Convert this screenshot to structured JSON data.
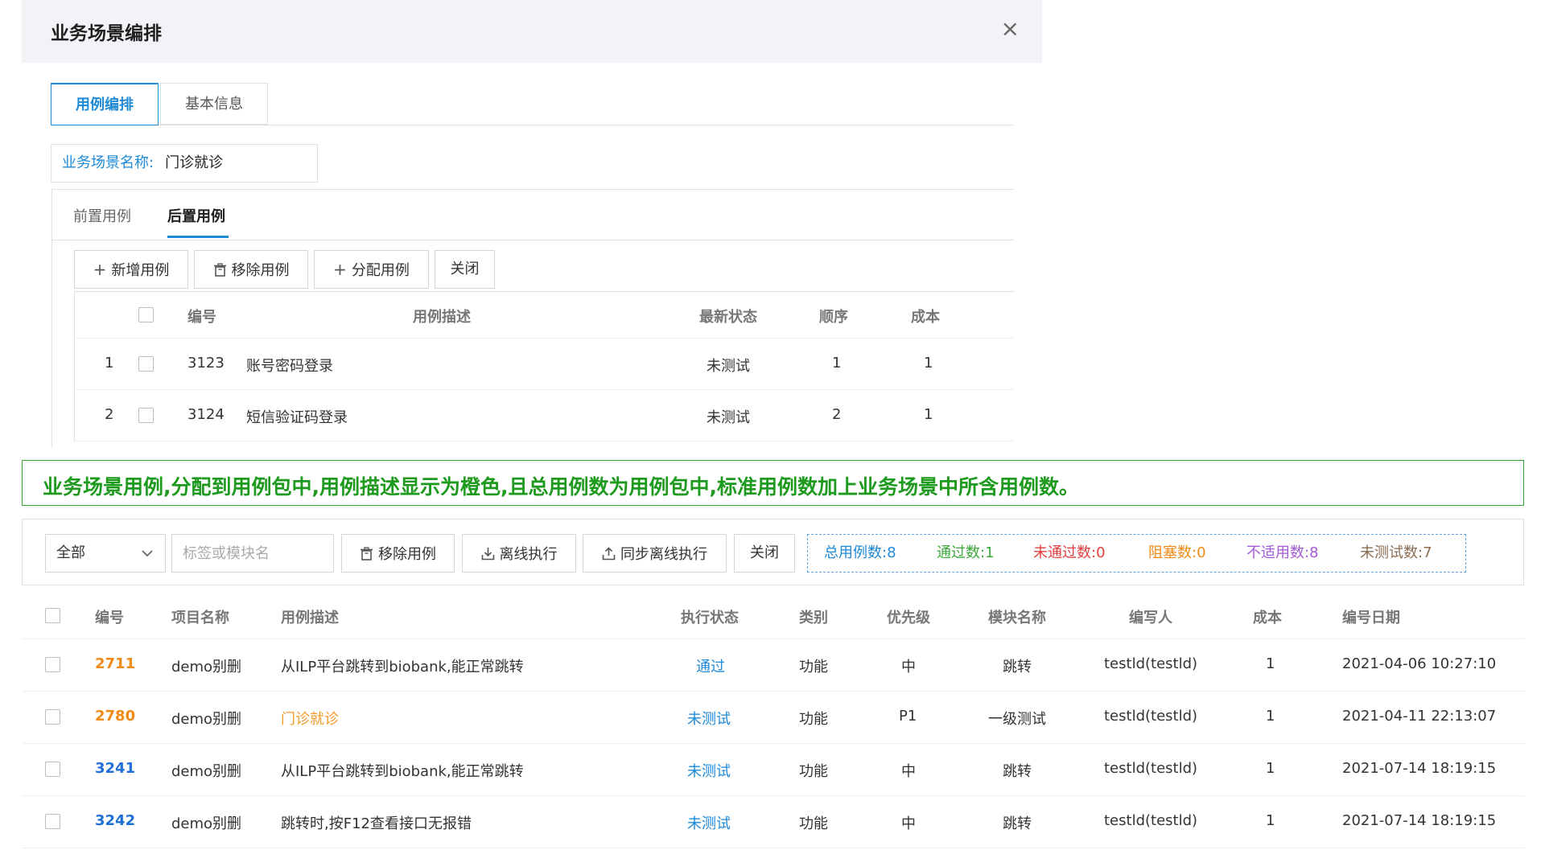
{
  "modal": {
    "title": "业务场景编排",
    "close_glyph": "×",
    "tabs": [
      {
        "label": "用例编排"
      },
      {
        "label": "基本信息"
      }
    ],
    "scene_name": {
      "label": "业务场景名称:",
      "value": "门诊就诊"
    },
    "inner_tabs": [
      {
        "label": "前置用例"
      },
      {
        "label": "后置用例"
      }
    ],
    "toolbar": {
      "add": "新增用例",
      "remove": "移除用例",
      "assign": "分配用例",
      "close": "关闭"
    },
    "table": {
      "headers": {
        "id": "编号",
        "desc": "用例描述",
        "status": "最新状态",
        "order": "顺序",
        "cost": "成本"
      },
      "rows": [
        {
          "index": "1",
          "id": "3123",
          "desc": "账号密码登录",
          "status": "未测试",
          "order": "1",
          "cost": "1"
        },
        {
          "index": "2",
          "id": "3124",
          "desc": "短信验证码登录",
          "status": "未测试",
          "order": "2",
          "cost": "1"
        }
      ]
    }
  },
  "banner": {
    "text": "业务场景用例,分配到用例包中,用例描述显示为橙色,且总用例数为用例包中,标准用例数加上业务场景中所含用例数。",
    "color": "#1e9a1e"
  },
  "lower": {
    "filter": {
      "selected": "全部",
      "placeholder": "标签或模块名"
    },
    "toolbar": {
      "remove": "移除用例",
      "offline": "离线执行",
      "sync_offline": "同步离线执行",
      "close": "关闭"
    },
    "stats": {
      "total": "总用例数:8",
      "pass": "通过数:1",
      "fail": "未通过数:0",
      "blocked": "阻塞数:0",
      "na": "不适用数:8",
      "untested": "未测试数:7"
    },
    "table": {
      "headers": {
        "id": "编号",
        "project": "项目名称",
        "desc": "用例描述",
        "exec_status": "执行状态",
        "category": "类别",
        "priority": "优先级",
        "module": "模块名称",
        "author": "编写人",
        "cost": "成本",
        "date": "编号日期"
      },
      "rows": [
        {
          "id": "2711",
          "project": "demo别删",
          "desc": "从ILP平台跳转到biobank,能正常跳转",
          "exec_status": "通过",
          "category": "功能",
          "priority": "中",
          "module": "跳转",
          "author": "testld(testld)",
          "cost": "1",
          "date": "2021-04-06 10:27:10",
          "id_color": "#f08a16",
          "desc_color": "#333333"
        },
        {
          "id": "2780",
          "project": "demo别删",
          "desc": "门诊就诊",
          "exec_status": "未测试",
          "category": "功能",
          "priority": "P1",
          "module": "一级测试",
          "author": "testld(testld)",
          "cost": "1",
          "date": "2021-04-11 22:13:07",
          "id_color": "#f08a16",
          "desc_color": "#f39a2b"
        },
        {
          "id": "3241",
          "project": "demo别删",
          "desc": "从ILP平台跳转到biobank,能正常跳转",
          "exec_status": "未测试",
          "category": "功能",
          "priority": "中",
          "module": "跳转",
          "author": "testld(testld)",
          "cost": "1",
          "date": "2021-07-14 18:19:15",
          "id_color": "#1f6fd6",
          "desc_color": "#333333"
        },
        {
          "id": "3242",
          "project": "demo别删",
          "desc": "跳转时,按F12查看接口无报错",
          "exec_status": "未测试",
          "category": "功能",
          "priority": "中",
          "module": "跳转",
          "author": "testld(testld)",
          "cost": "1",
          "date": "2021-07-14 18:19:15",
          "id_color": "#1f6fd6",
          "desc_color": "#333333"
        }
      ]
    }
  }
}
